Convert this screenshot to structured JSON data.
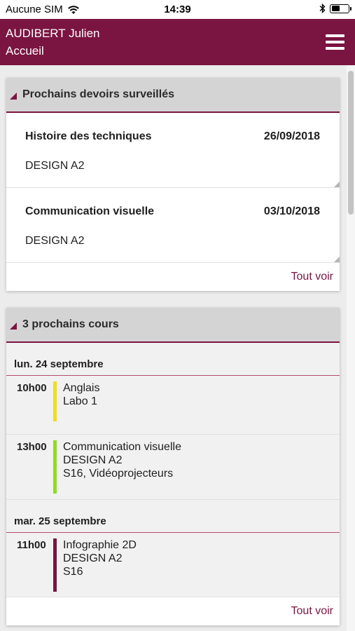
{
  "status": {
    "carrier": "Aucune SIM",
    "time": "14:39",
    "battery_level": 0.5
  },
  "header": {
    "user": "AUDIBERT Julien",
    "page": "Accueil"
  },
  "devoirs": {
    "title": "Prochains devoirs surveillés",
    "items": [
      {
        "subject": "Histoire des techniques",
        "date": "26/09/2018",
        "class": "DESIGN A2"
      },
      {
        "subject": "Communication visuelle",
        "date": "03/10/2018",
        "class": "DESIGN A2"
      }
    ],
    "see_all": "Tout voir"
  },
  "cours": {
    "title": "3 prochains cours",
    "days": [
      {
        "label": "lun. 24 septembre",
        "courses": [
          {
            "time": "10h00",
            "color": "#f0de1e",
            "lines": [
              "Anglais",
              "Labo 1"
            ]
          },
          {
            "time": "13h00",
            "color": "#8fdc1e",
            "lines": [
              "Communication visuelle",
              "DESIGN A2",
              "S16, Vidéoprojecteurs"
            ]
          }
        ]
      },
      {
        "label": "mar. 25 septembre",
        "courses": [
          {
            "time": "11h00",
            "color": "#7a1441",
            "lines": [
              "Infographie 2D",
              "DESIGN A2",
              "S16"
            ]
          }
        ]
      }
    ],
    "see_all": "Tout voir"
  },
  "colors": {
    "brand": "#7a1441",
    "card_header": "#d4d4d4"
  }
}
